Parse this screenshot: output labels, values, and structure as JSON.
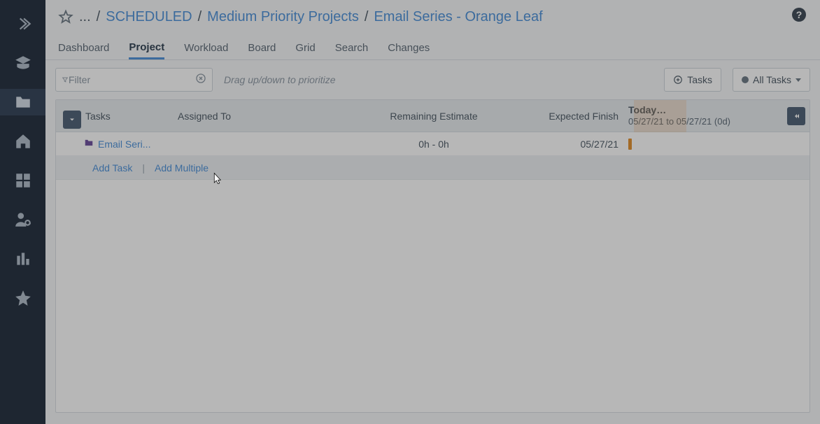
{
  "breadcrumbs": {
    "ellipsis": "...",
    "scheduled": "SCHEDULED",
    "medium": "Medium Priority Projects",
    "current": "Email Series - Orange Leaf"
  },
  "tabs": {
    "dashboard": "Dashboard",
    "project": "Project",
    "workload": "Workload",
    "board": "Board",
    "grid": "Grid",
    "search": "Search",
    "changes": "Changes"
  },
  "toolbar": {
    "filter_placeholder": "Filter",
    "prioritize_hint": "Drag up/down to prioritize",
    "tasks_label": "Tasks",
    "all_tasks_label": "All Tasks"
  },
  "columns": {
    "tasks": "Tasks",
    "assigned": "Assigned To",
    "remaining": "Remaining Estimate",
    "expected": "Expected Finish",
    "today": "Today…",
    "range": "05/27/21 to 05/27/21 (0d)"
  },
  "rows": [
    {
      "name": "Email Seri...",
      "assigned": "",
      "remaining": "0h - 0h",
      "expected": "05/27/21"
    }
  ],
  "add_row": {
    "add_task": "Add Task",
    "add_multiple": "Add Multiple"
  }
}
